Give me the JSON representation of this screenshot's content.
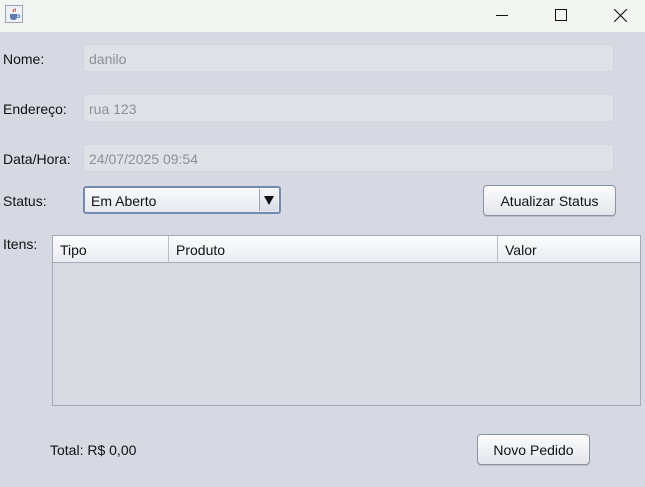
{
  "window": {
    "icon": "java-cup-icon",
    "controls": {
      "minimize": "minimize-icon",
      "maximize": "maximize-icon",
      "close": "close-icon"
    }
  },
  "form": {
    "nome_label": "Nome:",
    "nome_value": "danilo",
    "endereco_label": "Endereço:",
    "endereco_value": "rua 123",
    "datahora_label": "Data/Hora:",
    "datahora_value": "24/07/2025 09:54",
    "status_label": "Status:",
    "status_value": "Em Aberto",
    "atualizar_button": "Atualizar Status",
    "itens_label": "Itens:"
  },
  "table": {
    "columns": [
      "Tipo",
      "Produto",
      "Valor"
    ],
    "rows": []
  },
  "footer": {
    "total_text": "Total: R$ 0,00",
    "novo_pedido_button": "Novo Pedido"
  }
}
